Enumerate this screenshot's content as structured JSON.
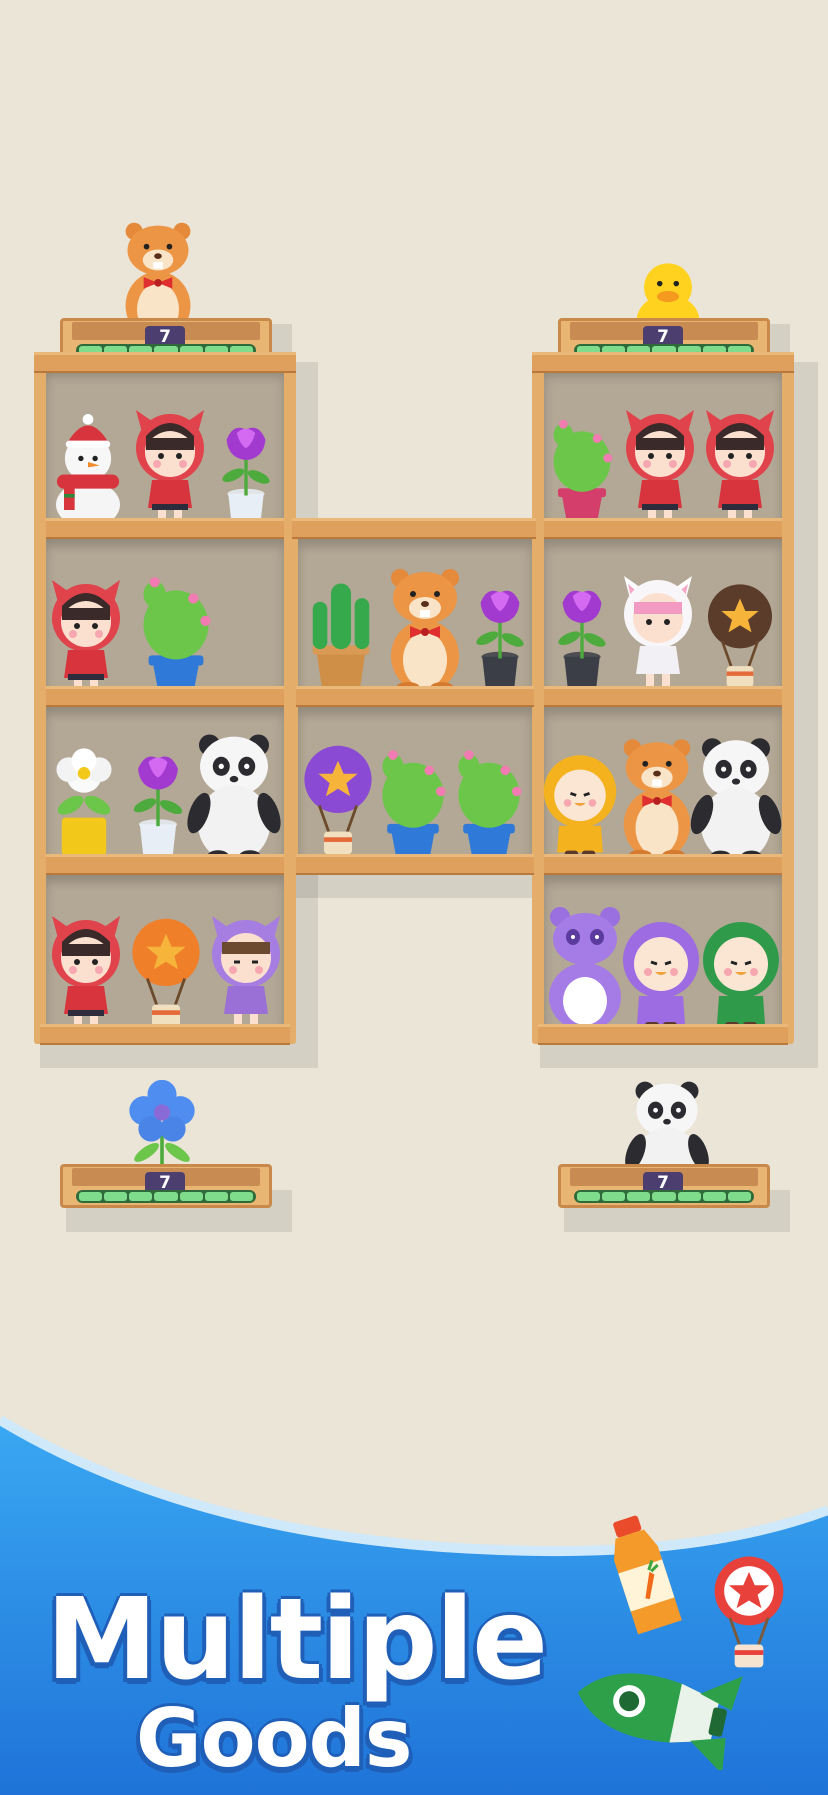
{
  "trays": [
    {
      "id": "top-left",
      "count": "7",
      "item": "hamster-toy"
    },
    {
      "id": "top-right",
      "count": "7",
      "item": "duck-toy"
    },
    {
      "id": "bottom-left",
      "count": "7",
      "item": "blue-flower"
    },
    {
      "id": "bottom-right",
      "count": "7",
      "item": "panda-toy"
    }
  ],
  "banner": {
    "line1": "Multiple",
    "line2": "Goods"
  },
  "decor": [
    "juice-bottle",
    "star-balloon",
    "green-rocket"
  ],
  "colors": {
    "background": "#ebe5d8",
    "banner": "#2f8ee6",
    "wood": "#e5ad6a",
    "progress": "#7fdc8d"
  }
}
